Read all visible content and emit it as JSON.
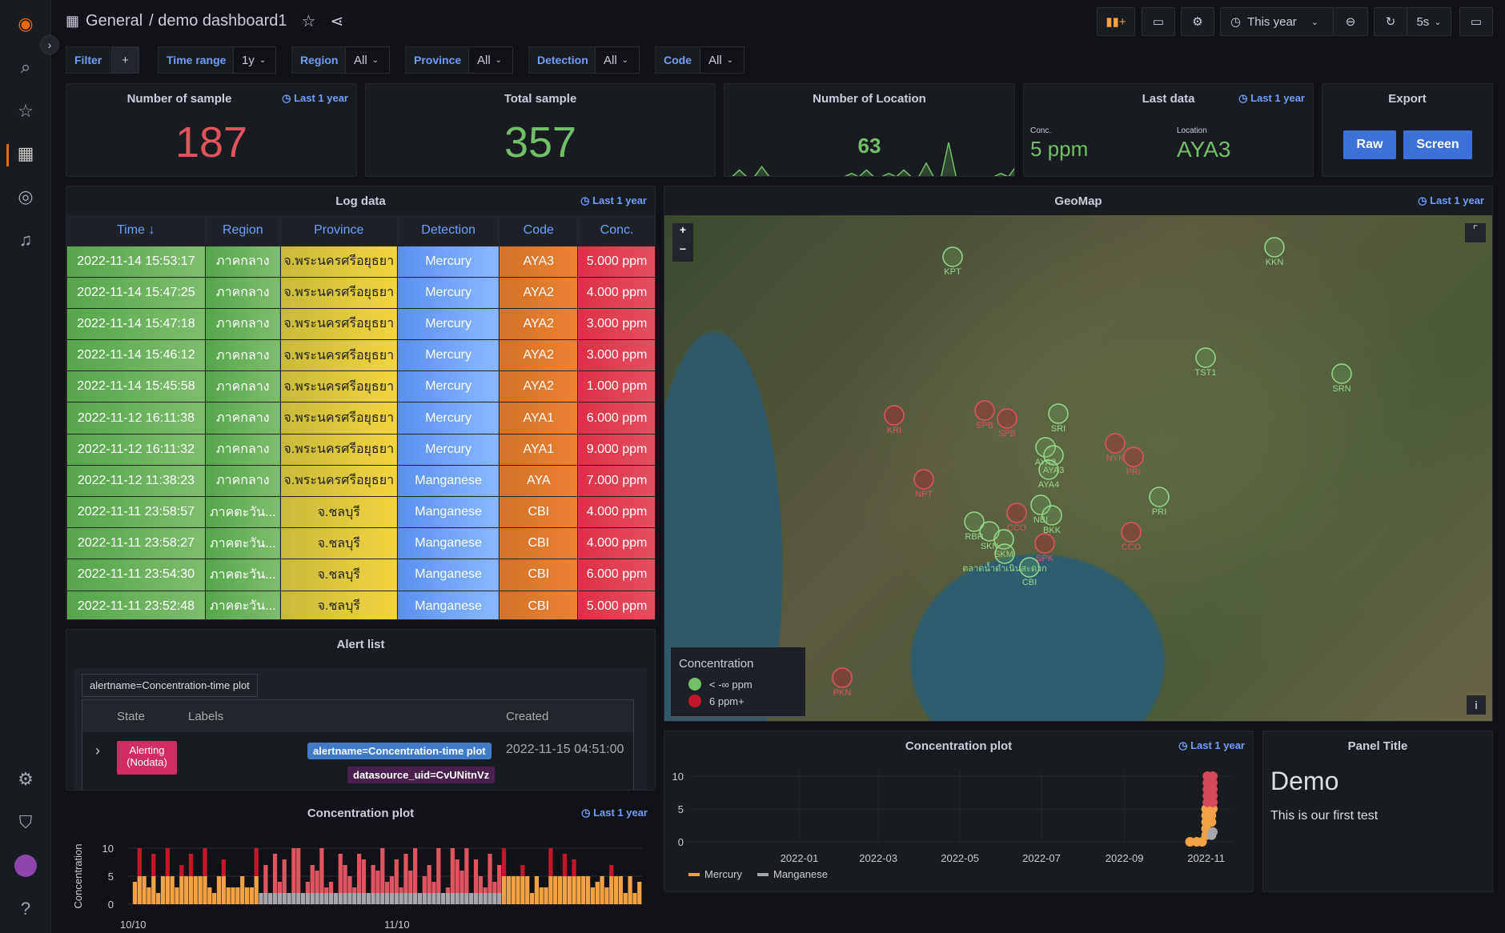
{
  "header": {
    "breadcrumb_root": "General",
    "breadcrumb_page": "/ demo dashboard1",
    "time_picker": "This year",
    "refresh_interval": "5s"
  },
  "sidebar": {
    "items": [
      "grafana-logo",
      "search",
      "starred",
      "dashboards",
      "explore",
      "alerting",
      "configuration",
      "server-admin",
      "user-avatar",
      "help"
    ]
  },
  "filters": {
    "filter_label": "Filter",
    "add": "+",
    "vars": [
      {
        "label": "Time range",
        "value": "1y"
      },
      {
        "label": "Region",
        "value": "All"
      },
      {
        "label": "Province",
        "value": "All"
      },
      {
        "label": "Detection",
        "value": "All"
      },
      {
        "label": "Code",
        "value": "All"
      }
    ]
  },
  "stats": {
    "num_sample": {
      "title": "Number of sample",
      "link": "Last 1 year",
      "value": "187",
      "color": "#e0535f"
    },
    "total_sample": {
      "title": "Total sample",
      "value": "357",
      "color": "#73bf69"
    },
    "num_location": {
      "title": "Number of Location",
      "value": "63",
      "sparkline": [
        0,
        0,
        2,
        0,
        0,
        3,
        0,
        0,
        0,
        0,
        0,
        0,
        0,
        0,
        0,
        0,
        0,
        1,
        0,
        2,
        0,
        0,
        1,
        0,
        2,
        0,
        0,
        4,
        0,
        0,
        10,
        0,
        0,
        0,
        0,
        0,
        0,
        1,
        0,
        3
      ]
    },
    "last_data": {
      "title": "Last data",
      "link": "Last 1 year",
      "conc_label": "Conc.",
      "conc_value": "5 ppm",
      "loc_label": "Location",
      "loc_value": "AYA3"
    },
    "export": {
      "title": "Export",
      "raw": "Raw",
      "screen": "Screen"
    }
  },
  "log": {
    "title": "Log data",
    "link": "Last 1 year",
    "columns": [
      "Time ↓",
      "Region",
      "Province",
      "Detection",
      "Code",
      "Conc."
    ],
    "rows": [
      [
        "2022-11-14 15:53:17",
        "ภาคกลาง",
        "จ.พระนครศรีอยุธยา",
        "Mercury",
        "AYA3",
        "5.000 ppm"
      ],
      [
        "2022-11-14 15:47:25",
        "ภาคกลาง",
        "จ.พระนครศรีอยุธยา",
        "Mercury",
        "AYA2",
        "4.000 ppm"
      ],
      [
        "2022-11-14 15:47:18",
        "ภาคกลาง",
        "จ.พระนครศรีอยุธยา",
        "Mercury",
        "AYA2",
        "3.000 ppm"
      ],
      [
        "2022-11-14 15:46:12",
        "ภาคกลาง",
        "จ.พระนครศรีอยุธยา",
        "Mercury",
        "AYA2",
        "3.000 ppm"
      ],
      [
        "2022-11-14 15:45:58",
        "ภาคกลาง",
        "จ.พระนครศรีอยุธยา",
        "Mercury",
        "AYA2",
        "1.000 ppm"
      ],
      [
        "2022-11-12 16:11:38",
        "ภาคกลาง",
        "จ.พระนครศรีอยุธยา",
        "Mercury",
        "AYA1",
        "6.000 ppm"
      ],
      [
        "2022-11-12 16:11:32",
        "ภาคกลาง",
        "จ.พระนครศรีอยุธยา",
        "Mercury",
        "AYA1",
        "9.000 ppm"
      ],
      [
        "2022-11-12 11:38:23",
        "ภาคกลาง",
        "จ.พระนครศรีอยุธยา",
        "Manganese",
        "AYA",
        "7.000 ppm"
      ],
      [
        "2022-11-11 23:58:57",
        "ภาคตะวัน...",
        "จ.ชลบุรี",
        "Manganese",
        "CBI",
        "4.000 ppm"
      ],
      [
        "2022-11-11 23:58:27",
        "ภาคตะวัน...",
        "จ.ชลบุรี",
        "Manganese",
        "CBI",
        "4.000 ppm"
      ],
      [
        "2022-11-11 23:54:30",
        "ภาคตะวัน...",
        "จ.ชลบุรี",
        "Manganese",
        "CBI",
        "6.000 ppm"
      ],
      [
        "2022-11-11 23:52:48",
        "ภาคตะวัน...",
        "จ.ชลบุรี",
        "Manganese",
        "CBI",
        "5.000 ppm"
      ]
    ]
  },
  "geomap": {
    "title": "GeoMap",
    "link": "Last 1 year",
    "zoom_in": "+",
    "zoom_out": "−",
    "info": "i",
    "legend": {
      "title": "Concentration",
      "items": [
        {
          "label": "< -∞ ppm",
          "color": "#73bf69"
        },
        {
          "label": "6 ppm+",
          "color": "#c4162a"
        }
      ]
    },
    "markers": [
      {
        "label": "KPT",
        "state": "low"
      },
      {
        "label": "KKN",
        "state": "low"
      },
      {
        "label": "TST1",
        "state": "low"
      },
      {
        "label": "SRN",
        "state": "low"
      },
      {
        "label": "KRI",
        "state": "high"
      },
      {
        "label": "SPB",
        "state": "high"
      },
      {
        "label": "SPB",
        "state": "high"
      },
      {
        "label": "SRI",
        "state": "low"
      },
      {
        "label": "AYA2",
        "state": "low"
      },
      {
        "label": "AYA3",
        "state": "low"
      },
      {
        "label": "AYA4",
        "state": "low"
      },
      {
        "label": "NYK",
        "state": "high"
      },
      {
        "label": "PRI",
        "state": "high"
      },
      {
        "label": "NPT",
        "state": "high"
      },
      {
        "label": "NBI",
        "state": "low"
      },
      {
        "label": "BKK",
        "state": "low"
      },
      {
        "label": "SPK",
        "state": "high"
      },
      {
        "label": "CCO",
        "state": "high"
      },
      {
        "label": "CCO",
        "state": "high"
      },
      {
        "label": "PRI",
        "state": "low"
      },
      {
        "label": "RBR",
        "state": "low"
      },
      {
        "label": "SKN",
        "state": "low"
      },
      {
        "label": "SKM",
        "state": "low"
      },
      {
        "label": "ตลาดน้ำดำเนินสะดวก",
        "state": "low"
      },
      {
        "label": "CBI",
        "state": "low"
      },
      {
        "label": "PKN",
        "state": "high"
      }
    ]
  },
  "alerts": {
    "title": "Alert list",
    "filter": "alertname=Concentration-time plot",
    "columns": [
      "State",
      "Labels",
      "Created"
    ],
    "rows": [
      {
        "state": "Alerting\n(Nodata)",
        "labels": [
          "alertname=Concentration-time plot",
          "datasource_uid=CvUNitnVz"
        ],
        "created": "2022-11-15 04:51:00"
      }
    ]
  },
  "chart_data": [
    {
      "type": "bar",
      "title": "Concentration plot",
      "link": "Last 1 year",
      "ylabel": "Concentration",
      "ylim": [
        0,
        10
      ],
      "yticks": [
        "0",
        "5",
        "10"
      ],
      "xticks": [
        "10/10",
        "11/10"
      ],
      "thresholds": {
        "low_color": "#f2a145",
        "high_color": "#e0535f",
        "manganese_color": "#a6a6ab"
      },
      "series": [
        {
          "name": "Mercury",
          "values": [
            0,
            4,
            10,
            5,
            3,
            9,
            2,
            5,
            10,
            5,
            3,
            7,
            5,
            9,
            5,
            5,
            10,
            3,
            2,
            5,
            8,
            3,
            3,
            3,
            5,
            3,
            3,
            10,
            10,
            5,
            5,
            5,
            7,
            5,
            2,
            5,
            3,
            3,
            10,
            5,
            5,
            9,
            5,
            8,
            5,
            5,
            5,
            3,
            4,
            5,
            3,
            7,
            5,
            5,
            2,
            5,
            2,
            4
          ]
        },
        {
          "name": "Manganese",
          "values": [
            2,
            7,
            2,
            9,
            4,
            8,
            2,
            10,
            10,
            2,
            4,
            7,
            6,
            10,
            3,
            4,
            2,
            9,
            7,
            5,
            3,
            9,
            8,
            2,
            7,
            6,
            10,
            4,
            5,
            8,
            3,
            9,
            6,
            10,
            2,
            5,
            7,
            4,
            10,
            2,
            3,
            10,
            8,
            6,
            10,
            2,
            8,
            5,
            3,
            9,
            4,
            7
          ]
        }
      ]
    },
    {
      "type": "scatter",
      "title": "Concentration plot",
      "link": "Last 1 year",
      "ylim": [
        0,
        10
      ],
      "yticks": [
        "0",
        "5",
        "10"
      ],
      "xticks": [
        "2022-01",
        "2022-03",
        "2022-05",
        "2022-07",
        "2022-09",
        "2022-11"
      ],
      "series": [
        {
          "name": "Mercury",
          "color": "#f2a145",
          "points": [
            [
              "2022-10-20",
              0
            ],
            [
              "2022-10-25",
              0
            ],
            [
              "2022-10-29",
              0
            ],
            [
              "2022-11-01",
              1
            ],
            [
              "2022-11-01",
              2
            ],
            [
              "2022-11-01",
              3
            ],
            [
              "2022-11-01",
              4
            ],
            [
              "2022-11-01",
              5
            ],
            [
              "2022-11-02",
              6
            ],
            [
              "2022-11-02",
              7
            ],
            [
              "2022-11-02",
              8
            ],
            [
              "2022-11-02",
              9
            ],
            [
              "2022-11-02",
              10
            ],
            [
              "2022-11-05",
              3
            ],
            [
              "2022-11-05",
              4
            ],
            [
              "2022-11-06",
              5
            ],
            [
              "2022-11-06",
              6
            ],
            [
              "2022-11-06",
              7
            ],
            [
              "2022-11-06",
              8
            ],
            [
              "2022-11-06",
              9
            ],
            [
              "2022-11-06",
              10
            ]
          ]
        },
        {
          "name": "Manganese",
          "color": "#a6a6ab",
          "points": [
            [
              "2022-11-05",
              1
            ],
            [
              "2022-11-06",
              1.5
            ]
          ]
        }
      ]
    }
  ],
  "text_panel": {
    "title": "Panel Title",
    "heading": "Demo",
    "body": "This is our first test"
  }
}
